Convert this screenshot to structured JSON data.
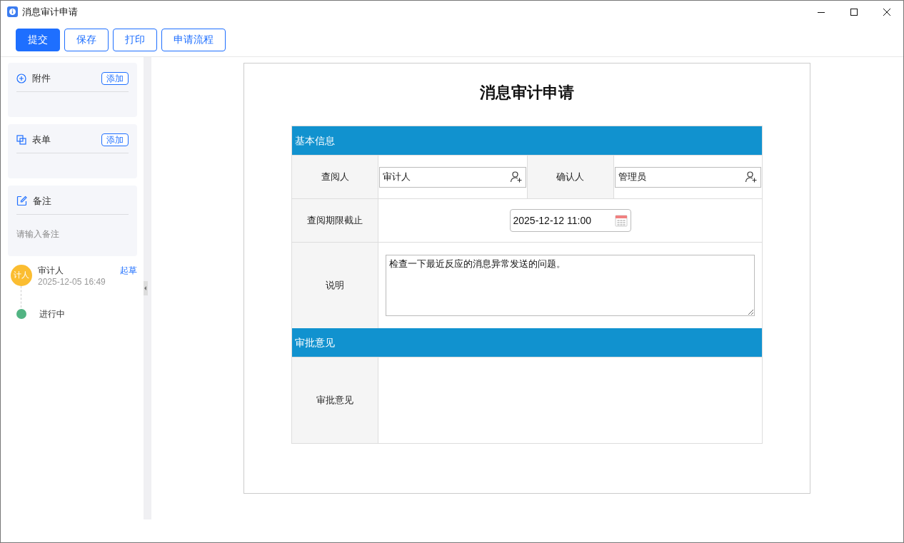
{
  "window": {
    "title": "消息审计申请"
  },
  "toolbar": {
    "buttons": [
      {
        "label": "提交",
        "kind": "primary"
      },
      {
        "label": "保存",
        "kind": "outline"
      },
      {
        "label": "打印",
        "kind": "outline"
      },
      {
        "label": "申请流程",
        "kind": "outline"
      }
    ]
  },
  "sidebar": {
    "panels": [
      {
        "kind": "attachments",
        "title": "附件",
        "action": "添加"
      },
      {
        "kind": "forms",
        "title": "表单",
        "action": "添加"
      },
      {
        "kind": "notes",
        "title": "备注",
        "placeholder": "请输入备注"
      }
    ],
    "timeline": [
      {
        "kind": "person",
        "avatar": "计人",
        "name": "审计人",
        "time": "2025-12-05 16:49",
        "link": "起草"
      },
      {
        "kind": "status",
        "label": "进行中",
        "color": "#52b483"
      }
    ]
  },
  "form": {
    "title": "消息审计申请",
    "sections": [
      {
        "title": "基本信息",
        "rows": [
          {
            "kind": "pair",
            "fields": [
              {
                "label": "查阅人",
                "value": "审计人"
              },
              {
                "label": "确认人",
                "value": "管理员"
              }
            ]
          },
          {
            "kind": "datetime",
            "label": "查阅期限截止",
            "value": "2025-12-12 11:00"
          },
          {
            "kind": "textarea",
            "label": "说明",
            "value": "检查一下最近反应的消息异常发送的问题。"
          }
        ]
      },
      {
        "title": "审批意见",
        "rows": [
          {
            "kind": "blank",
            "label": "审批意见"
          }
        ]
      }
    ]
  }
}
